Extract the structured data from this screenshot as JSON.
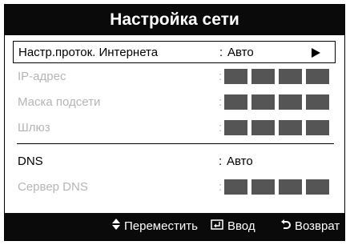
{
  "title": "Настройка сети",
  "rows": [
    {
      "label": "Настр.проток. Интернета",
      "value": "Авто",
      "state": "selected"
    },
    {
      "label": "IP-адрес",
      "value": "",
      "state": "disabled"
    },
    {
      "label": "Маска подсети",
      "value": "",
      "state": "disabled"
    },
    {
      "label": "Шлюз",
      "value": "",
      "state": "disabled"
    },
    {
      "label": "DNS",
      "value": "Авто",
      "state": "enabled"
    },
    {
      "label": "Сервер DNS",
      "value": "",
      "state": "disabled"
    }
  ],
  "colon": ":",
  "footer": {
    "move": "Переместить",
    "enter": "Ввод",
    "back": "Возврат"
  },
  "colors": {
    "title_bg": "#0a0a0a",
    "block": "#555555",
    "disabled_text": "#b5b5b5"
  }
}
